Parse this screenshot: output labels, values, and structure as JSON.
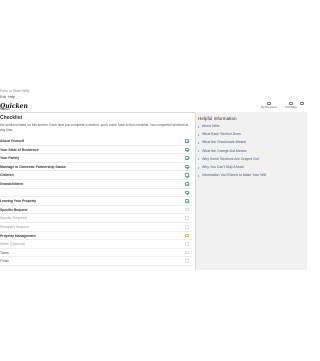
{
  "window": {
    "title": "Form of State Wills"
  },
  "menu": {
    "items": [
      "Edit",
      "Help"
    ]
  },
  "toolbar": {
    "logo": "Quicken",
    "logo_sub": "WillMaker",
    "buttons": [
      {
        "icon": "document-icon",
        "label": "My Document"
      },
      {
        "icon": "print-icon",
        "label": "Print/Save"
      },
      {
        "icon": "next-icon",
        "label": ""
      }
    ]
  },
  "checklist": {
    "title": "Checklist",
    "intro": "the sections listed on this screen. Each time you complete a section, you'll come back to this checklist. You completed sections at any time.",
    "rows": [
      {
        "label": "About Yourself",
        "state": "done",
        "style": "bold"
      },
      {
        "label": "Your State of Residence",
        "state": "done",
        "style": "bold"
      },
      {
        "label": "Your Family",
        "state": "done",
        "style": "bold"
      },
      {
        "label": "Marriage or Domestic Partnership Status",
        "state": "done",
        "style": "bold"
      },
      {
        "label": "Children",
        "state": "done",
        "style": "bold"
      },
      {
        "label": "Grandchildren",
        "state": "done",
        "style": "bold"
      },
      {
        "label": "",
        "state": "done",
        "style": "bold"
      },
      {
        "label": "Leaving Your Property",
        "state": "done",
        "style": "bold"
      },
      {
        "label": "Specific Bequest",
        "state": "empty",
        "style": "bold"
      },
      {
        "label": "Specific Requests",
        "state": "empty",
        "style": "dim"
      },
      {
        "label": "Residuary Bequest",
        "state": "empty",
        "style": "dim"
      },
      {
        "label": "Property Management",
        "state": "warn",
        "style": "bold"
      },
      {
        "label": "Debts (Optional)",
        "state": "empty",
        "style": "dim"
      },
      {
        "label": "Taxes",
        "state": "empty",
        "style": "plain"
      },
      {
        "label": "Finish",
        "state": "empty",
        "style": "plain"
      }
    ]
  },
  "help": {
    "title": "Helpful Information",
    "items": [
      "About Wills",
      "What Each Section Does",
      "What the Checkmark Means",
      "What the Orange Dot Means",
      "Why Some Sections Are Grayed Out",
      "Why You Can't Skip Ahead",
      "Information You'll Need to Make Your Will"
    ]
  }
}
